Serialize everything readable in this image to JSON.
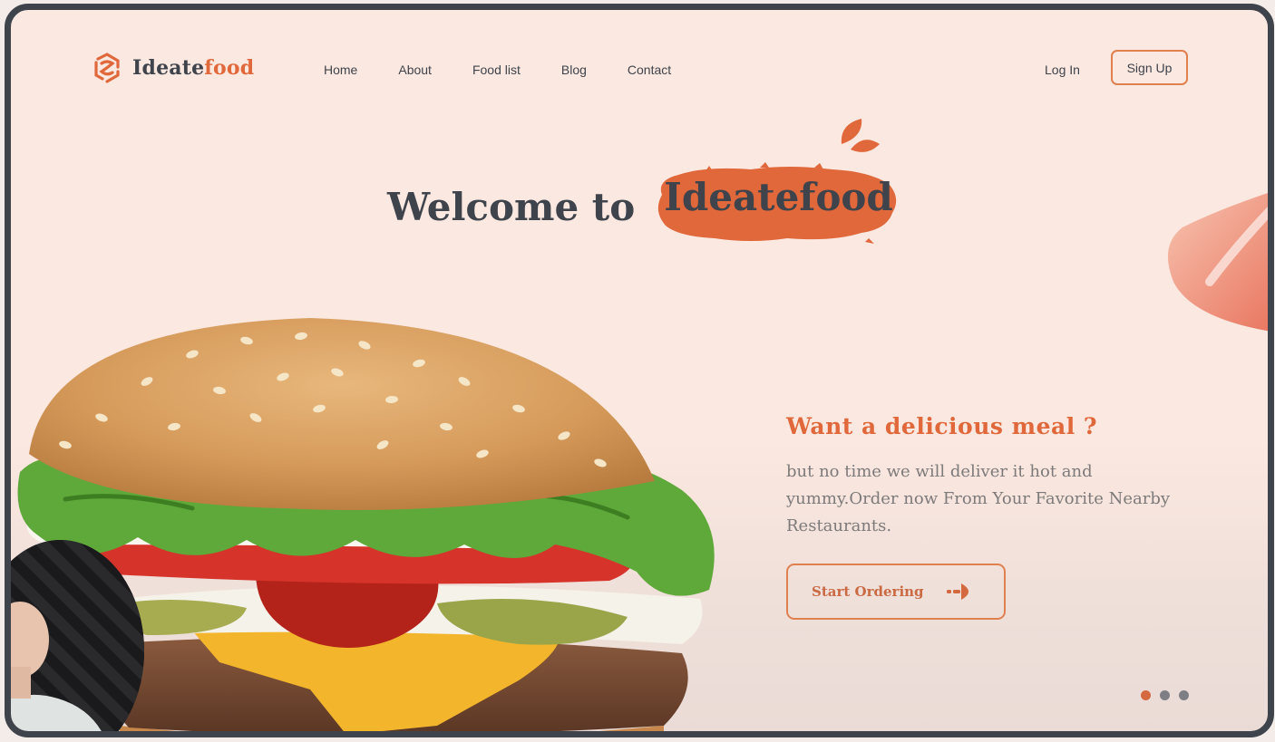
{
  "brand": {
    "name_part1": "Ideate",
    "name_part2": "food"
  },
  "nav": {
    "items": [
      {
        "label": "Home"
      },
      {
        "label": "About"
      },
      {
        "label": "Food list"
      },
      {
        "label": "Blog"
      },
      {
        "label": "Contact"
      }
    ]
  },
  "auth": {
    "login_label": "Log In",
    "signup_label": "Sign Up"
  },
  "hero": {
    "welcome": "Welcome to",
    "brand_highlight": "Ideatefood",
    "headline": "Want a delicious meal ?",
    "description": "but no time we will deliver it hot and yummy.Order now From Your Favorite Nearby Restaurants.",
    "cta_label": "Start Ordering"
  },
  "carousel": {
    "slides": 3,
    "active": 1
  },
  "colors": {
    "accent": "#e0683a",
    "dark": "#3f434c",
    "background": "#fbe8e0",
    "muted_text": "#7c7a7a"
  },
  "icons": [
    "logo-mark-icon",
    "leaf-icon",
    "arrow-right-icon"
  ]
}
